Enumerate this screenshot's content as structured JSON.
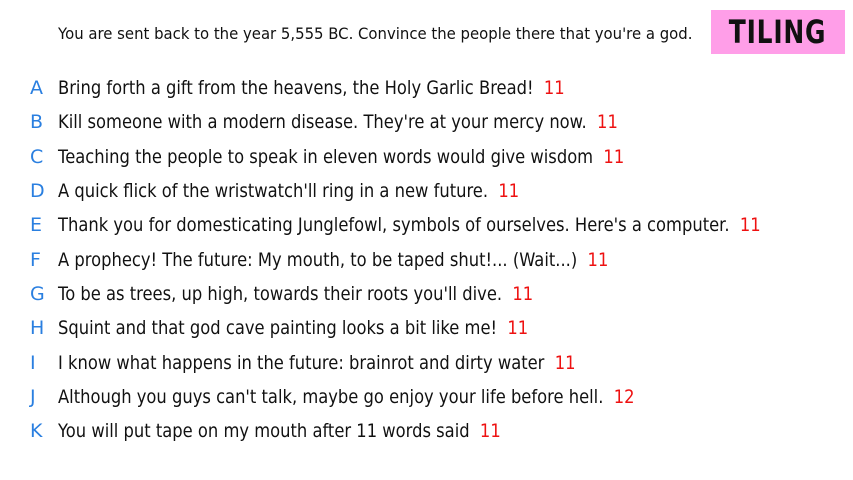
{
  "prompt": "You are sent back to the year 5,555 BC. Convince the people there that you're a god.",
  "badge": {
    "label": "TILING",
    "color": "#ff9ee8"
  },
  "colors": {
    "letter": "#2a7fe0",
    "count": "#ee1111",
    "text": "#111111"
  },
  "answers": [
    {
      "letter": "A",
      "text": "Bring forth a gift from the heavens, the Holy Garlic Bread!",
      "count": "11"
    },
    {
      "letter": "B",
      "text": "Kill someone with a modern disease. They're at your mercy now.",
      "count": "11"
    },
    {
      "letter": "C",
      "text": "Teaching the people to speak in eleven words would give wisdom",
      "count": "11"
    },
    {
      "letter": "D",
      "text": "A quick flick of the wristwatch'll ring in a new future.",
      "count": "11"
    },
    {
      "letter": "E",
      "text": "Thank you for domesticating Junglefowl, symbols of ourselves. Here's a computer.",
      "count": "11"
    },
    {
      "letter": "F",
      "text": "A prophecy!  The future: My mouth, to be taped shut!... (Wait...)",
      "count": "11"
    },
    {
      "letter": "G",
      "text": "To be as trees, up high, towards their roots you'll dive.",
      "count": "11"
    },
    {
      "letter": "H",
      "text": "Squint and that god cave painting looks a bit like me!",
      "count": "11"
    },
    {
      "letter": "I",
      "text": "I know what happens in the future: brainrot and dirty water",
      "count": "11"
    },
    {
      "letter": "J",
      "text": "Although you guys can't talk, maybe go enjoy your life before hell.",
      "count": "12"
    },
    {
      "letter": "K",
      "text": "You will put tape on my mouth after 11 words said",
      "count": "11"
    }
  ]
}
